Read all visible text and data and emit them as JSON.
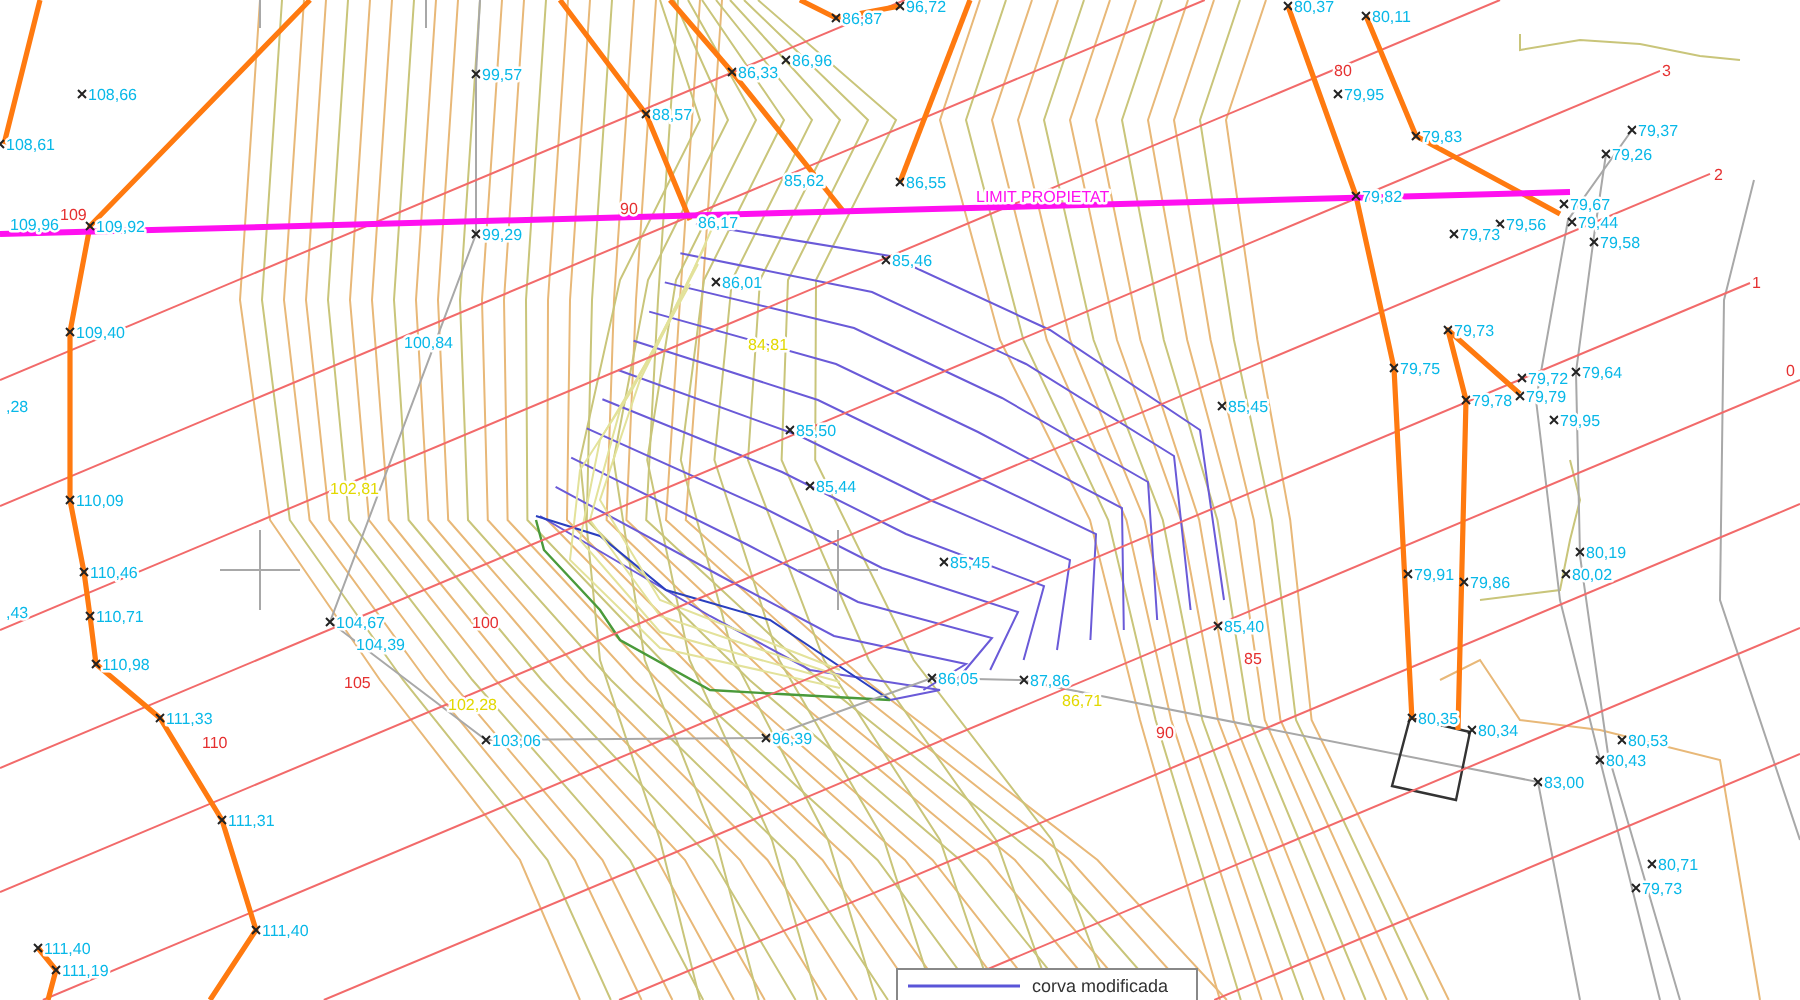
{
  "drawing": {
    "property_line": {
      "label": "LIMIT PROPIETAT"
    },
    "spot_elevations": [
      {
        "text": "86,87",
        "marker": true
      },
      {
        "text": "96,72",
        "marker": true
      },
      {
        "text": "108,66",
        "marker": true
      },
      {
        "text": "108,61",
        "marker": true
      },
      {
        "text": "99,57",
        "marker": true
      },
      {
        "text": "86,33",
        "marker": true
      },
      {
        "text": "86,96",
        "marker": true
      },
      {
        "text": "88,57",
        "marker": true
      },
      {
        "text": "85,62",
        "marker": false
      },
      {
        "text": "86,55",
        "marker": true
      },
      {
        "text": "109,96",
        "marker": false
      },
      {
        "text": "109,92",
        "marker": true
      },
      {
        "text": "99,29",
        "marker": true
      },
      {
        "text": "86,17",
        "marker": false
      },
      {
        "text": "85,46",
        "marker": true
      },
      {
        "text": "86,01",
        "marker": true
      },
      {
        "text": "109,40",
        "marker": true
      },
      {
        "text": "100,84",
        "marker": false
      },
      {
        "text": ",28",
        "marker": false
      },
      {
        "text": "85,50",
        "marker": true
      },
      {
        "text": "85,44",
        "marker": true
      },
      {
        "text": "110,09",
        "marker": true
      },
      {
        "text": "110,46",
        "marker": true
      },
      {
        "text": ",43",
        "marker": false
      },
      {
        "text": "110,71",
        "marker": true
      },
      {
        "text": "110,98",
        "marker": true
      },
      {
        "text": "104,67",
        "marker": true
      },
      {
        "text": "104,39",
        "marker": false
      },
      {
        "text": "111,33",
        "marker": true
      },
      {
        "text": "103,06",
        "marker": true
      },
      {
        "text": "96,39",
        "marker": true
      },
      {
        "text": "111,31",
        "marker": true
      },
      {
        "text": "111,40",
        "marker": true
      },
      {
        "text": "111,40",
        "marker": true
      },
      {
        "text": "111,19",
        "marker": true
      },
      {
        "text": "85,45",
        "marker": true
      },
      {
        "text": "85,45",
        "marker": true
      },
      {
        "text": "85,40",
        "marker": true
      },
      {
        "text": "86,05",
        "marker": true
      },
      {
        "text": "87,86",
        "marker": true
      },
      {
        "text": "80,37",
        "marker": true
      },
      {
        "text": "80,11",
        "marker": true
      },
      {
        "text": "79,95",
        "marker": true
      },
      {
        "text": "79,83",
        "marker": true
      },
      {
        "text": "79,37",
        "marker": true
      },
      {
        "text": "79,26",
        "marker": true
      },
      {
        "text": "79,82",
        "marker": true
      },
      {
        "text": "79,56",
        "marker": true
      },
      {
        "text": "79,67",
        "marker": true
      },
      {
        "text": "79,44",
        "marker": true
      },
      {
        "text": "79,73",
        "marker": true
      },
      {
        "text": "79,58",
        "marker": true
      },
      {
        "text": "79,73",
        "marker": true
      },
      {
        "text": "79,75",
        "marker": true
      },
      {
        "text": "79,72",
        "marker": true
      },
      {
        "text": "79,64",
        "marker": true
      },
      {
        "text": "79,78",
        "marker": true
      },
      {
        "text": "79,79",
        "marker": true
      },
      {
        "text": "79,95",
        "marker": true
      },
      {
        "text": "80,19",
        "marker": true
      },
      {
        "text": "79,91",
        "marker": true
      },
      {
        "text": "79,86",
        "marker": true
      },
      {
        "text": "80,02",
        "marker": true
      },
      {
        "text": "80,35",
        "marker": true
      },
      {
        "text": "80,34",
        "marker": true
      },
      {
        "text": "80,53",
        "marker": true
      },
      {
        "text": "80,43",
        "marker": true
      },
      {
        "text": "83,00",
        "marker": true
      },
      {
        "text": "80,71",
        "marker": true
      },
      {
        "text": "79,73",
        "marker": true
      }
    ],
    "contour_labels": [
      {
        "text": "109"
      },
      {
        "text": "90"
      },
      {
        "text": "80"
      },
      {
        "text": "100"
      },
      {
        "text": "105"
      },
      {
        "text": "110"
      },
      {
        "text": "85"
      },
      {
        "text": "90"
      }
    ],
    "section_numbers": [
      {
        "text": "3"
      },
      {
        "text": "2"
      },
      {
        "text": "1"
      },
      {
        "text": "0"
      }
    ],
    "highlighted_elevations": [
      {
        "text": "84,81"
      },
      {
        "text": "102,81"
      },
      {
        "text": "102,28"
      },
      {
        "text": "86,71"
      }
    ],
    "legend": {
      "entries": [
        {
          "label": "corva modificada"
        }
      ]
    }
  }
}
